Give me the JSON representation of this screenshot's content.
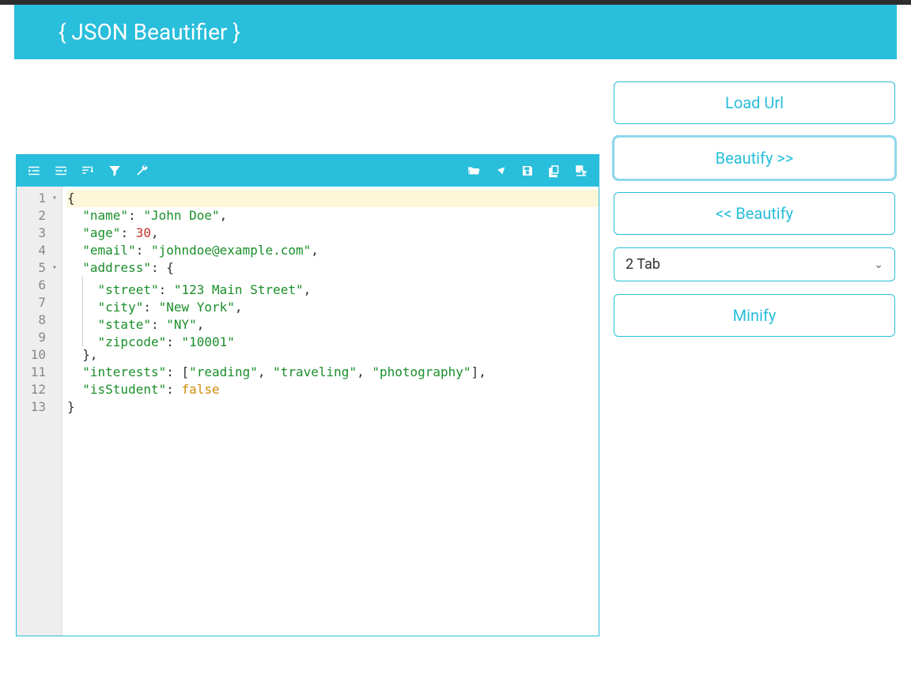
{
  "header": {
    "title": "{ JSON Beautifier }"
  },
  "sidebar": {
    "load_url": "Load Url",
    "beautify_right": "Beautify >>",
    "beautify_left": "<< Beautify",
    "minify": "Minify",
    "indent_value": "2 Tab"
  },
  "toolbar_left_icons": [
    "indent-right-icon",
    "indent-left-icon",
    "sort-icon",
    "filter-icon",
    "wrench-icon"
  ],
  "toolbar_right_icons": [
    "folder-open-icon",
    "clear-icon",
    "save-icon",
    "copy-icon",
    "edit-icon"
  ],
  "editor": {
    "lines": [
      {
        "n": "1",
        "fold": true,
        "hl": true,
        "tokens": [
          {
            "t": "{",
            "c": "punc"
          }
        ]
      },
      {
        "n": "2",
        "tokens": [
          {
            "t": "  ",
            "c": "sp"
          },
          {
            "t": "\"name\"",
            "c": "key"
          },
          {
            "t": ": ",
            "c": "punc"
          },
          {
            "t": "\"John Doe\"",
            "c": "str"
          },
          {
            "t": ",",
            "c": "punc"
          }
        ]
      },
      {
        "n": "3",
        "tokens": [
          {
            "t": "  ",
            "c": "sp"
          },
          {
            "t": "\"age\"",
            "c": "key"
          },
          {
            "t": ": ",
            "c": "punc"
          },
          {
            "t": "30",
            "c": "num"
          },
          {
            "t": ",",
            "c": "punc"
          }
        ]
      },
      {
        "n": "4",
        "tokens": [
          {
            "t": "  ",
            "c": "sp"
          },
          {
            "t": "\"email\"",
            "c": "key"
          },
          {
            "t": ": ",
            "c": "punc"
          },
          {
            "t": "\"johndoe@example.com\"",
            "c": "str"
          },
          {
            "t": ",",
            "c": "punc"
          }
        ]
      },
      {
        "n": "5",
        "fold": true,
        "tokens": [
          {
            "t": "  ",
            "c": "sp"
          },
          {
            "t": "\"address\"",
            "c": "key"
          },
          {
            "t": ": {",
            "c": "punc"
          }
        ]
      },
      {
        "n": "6",
        "tokens": [
          {
            "t": "    ",
            "c": "sp2"
          },
          {
            "t": "\"street\"",
            "c": "key"
          },
          {
            "t": ": ",
            "c": "punc"
          },
          {
            "t": "\"123 Main Street\"",
            "c": "str"
          },
          {
            "t": ",",
            "c": "punc"
          }
        ]
      },
      {
        "n": "7",
        "tokens": [
          {
            "t": "    ",
            "c": "sp2"
          },
          {
            "t": "\"city\"",
            "c": "key"
          },
          {
            "t": ": ",
            "c": "punc"
          },
          {
            "t": "\"New York\"",
            "c": "str"
          },
          {
            "t": ",",
            "c": "punc"
          }
        ]
      },
      {
        "n": "8",
        "tokens": [
          {
            "t": "    ",
            "c": "sp2"
          },
          {
            "t": "\"state\"",
            "c": "key"
          },
          {
            "t": ": ",
            "c": "punc"
          },
          {
            "t": "\"NY\"",
            "c": "str"
          },
          {
            "t": ",",
            "c": "punc"
          }
        ]
      },
      {
        "n": "9",
        "tokens": [
          {
            "t": "    ",
            "c": "sp2"
          },
          {
            "t": "\"zipcode\"",
            "c": "key"
          },
          {
            "t": ": ",
            "c": "punc"
          },
          {
            "t": "\"10001\"",
            "c": "str"
          }
        ]
      },
      {
        "n": "10",
        "tokens": [
          {
            "t": "  ",
            "c": "sp"
          },
          {
            "t": "},",
            "c": "punc"
          }
        ]
      },
      {
        "n": "11",
        "tokens": [
          {
            "t": "  ",
            "c": "sp"
          },
          {
            "t": "\"interests\"",
            "c": "key"
          },
          {
            "t": ": [",
            "c": "punc"
          },
          {
            "t": "\"reading\"",
            "c": "str"
          },
          {
            "t": ", ",
            "c": "punc"
          },
          {
            "t": "\"traveling\"",
            "c": "str"
          },
          {
            "t": ", ",
            "c": "punc"
          },
          {
            "t": "\"photography\"",
            "c": "str"
          },
          {
            "t": "],",
            "c": "punc"
          }
        ]
      },
      {
        "n": "12",
        "tokens": [
          {
            "t": "  ",
            "c": "sp"
          },
          {
            "t": "\"isStudent\"",
            "c": "key"
          },
          {
            "t": ": ",
            "c": "punc"
          },
          {
            "t": "false",
            "c": "bool"
          }
        ]
      },
      {
        "n": "13",
        "tokens": [
          {
            "t": "}",
            "c": "punc"
          }
        ]
      }
    ]
  }
}
